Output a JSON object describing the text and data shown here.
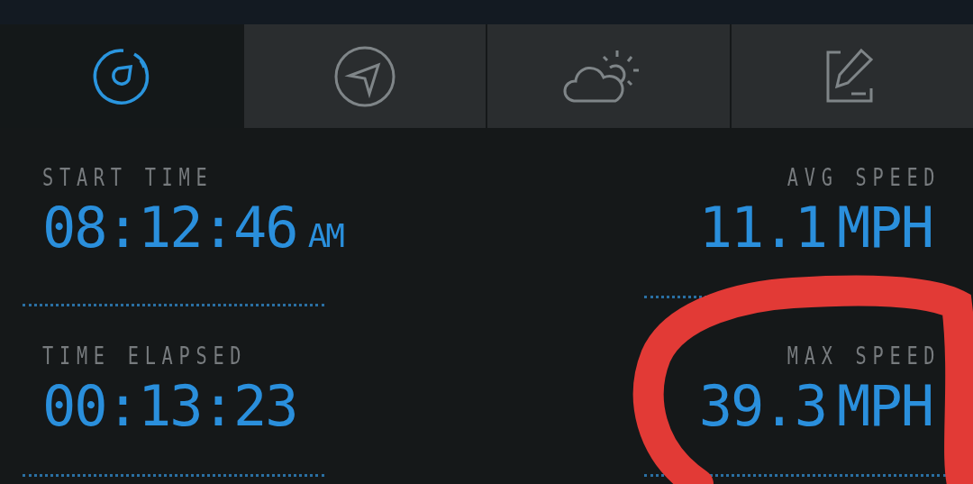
{
  "tabs": [
    {
      "kind": "speedometer",
      "selected": true
    },
    {
      "kind": "compass",
      "selected": false
    },
    {
      "kind": "weather",
      "selected": false
    },
    {
      "kind": "edit",
      "selected": false
    }
  ],
  "stats": [
    {
      "label": "START TIME",
      "value": "08:12:46",
      "unit": "AM"
    },
    {
      "label": "AVG SPEED",
      "value": "11.1",
      "unit": "MPH"
    },
    {
      "label": "TIME ELAPSED",
      "value": "00:13:23"
    },
    {
      "label": "MAX SPEED",
      "value": "39.3",
      "unit": "MPH"
    }
  ],
  "annotation": {
    "kind": "circle"
  }
}
